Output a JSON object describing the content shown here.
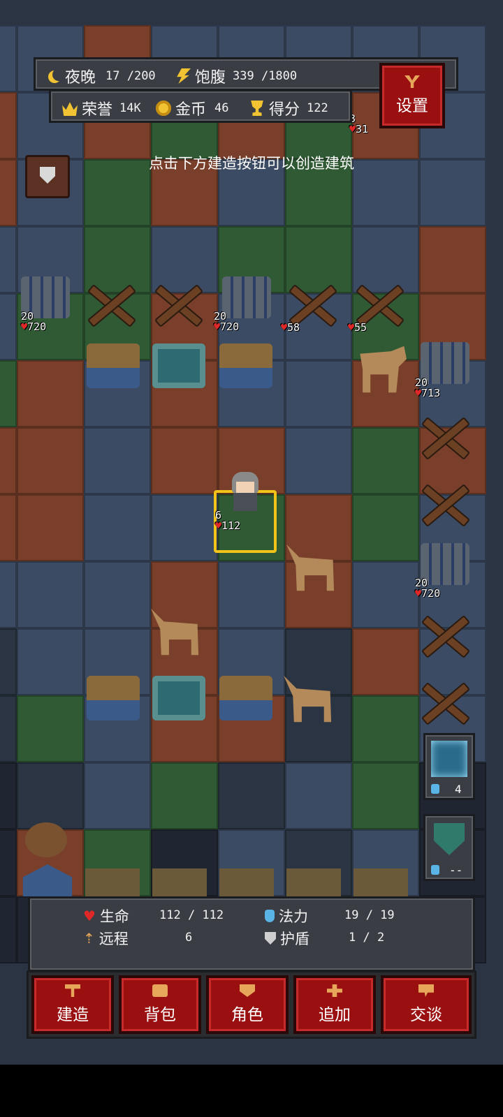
{
  "top_bar": {
    "time_label": "夜晚",
    "time_value": "17 /200",
    "hunger_label": "饱腹",
    "hunger_value": "339 /1800",
    "honor_label": "荣誉",
    "honor_value": "14K",
    "gold_label": "金币",
    "gold_value": "46",
    "score_label": "得分",
    "score_value": "122"
  },
  "settings_button": {
    "label": "设置"
  },
  "hint_text": "点击下方建造按钮可以创造建筑",
  "map_counters": {
    "corner_top": "3",
    "corner_hp": "31",
    "archers_1_atk": "20",
    "archers_1_hp": "720",
    "archers_2_atk": "20",
    "archers_2_hp": "720",
    "spike_1_hp": "58",
    "spike_2_hp": "55",
    "archers_3_atk": "20",
    "archers_3_hp": "713",
    "player_atk": "6",
    "player_hp": "112",
    "archers_4_atk": "20",
    "archers_4_hp": "720"
  },
  "skills": {
    "lightning_cost": "4",
    "shield_cost": "--"
  },
  "stats": {
    "hp_label": "生命",
    "hp_value": "112 / 112",
    "mana_label": "法力",
    "mana_value": "19 / 19",
    "range_label": "远程",
    "range_value": "6",
    "shield_label": "护盾",
    "shield_value": "1 / 2"
  },
  "bottom_buttons": {
    "build": "建造",
    "bag": "背包",
    "character": "角色",
    "add": "追加",
    "talk": "交谈"
  },
  "colors": {
    "accent_red": "#9a1010",
    "gold": "#f1c232",
    "selected_tile": "#f2c318"
  }
}
